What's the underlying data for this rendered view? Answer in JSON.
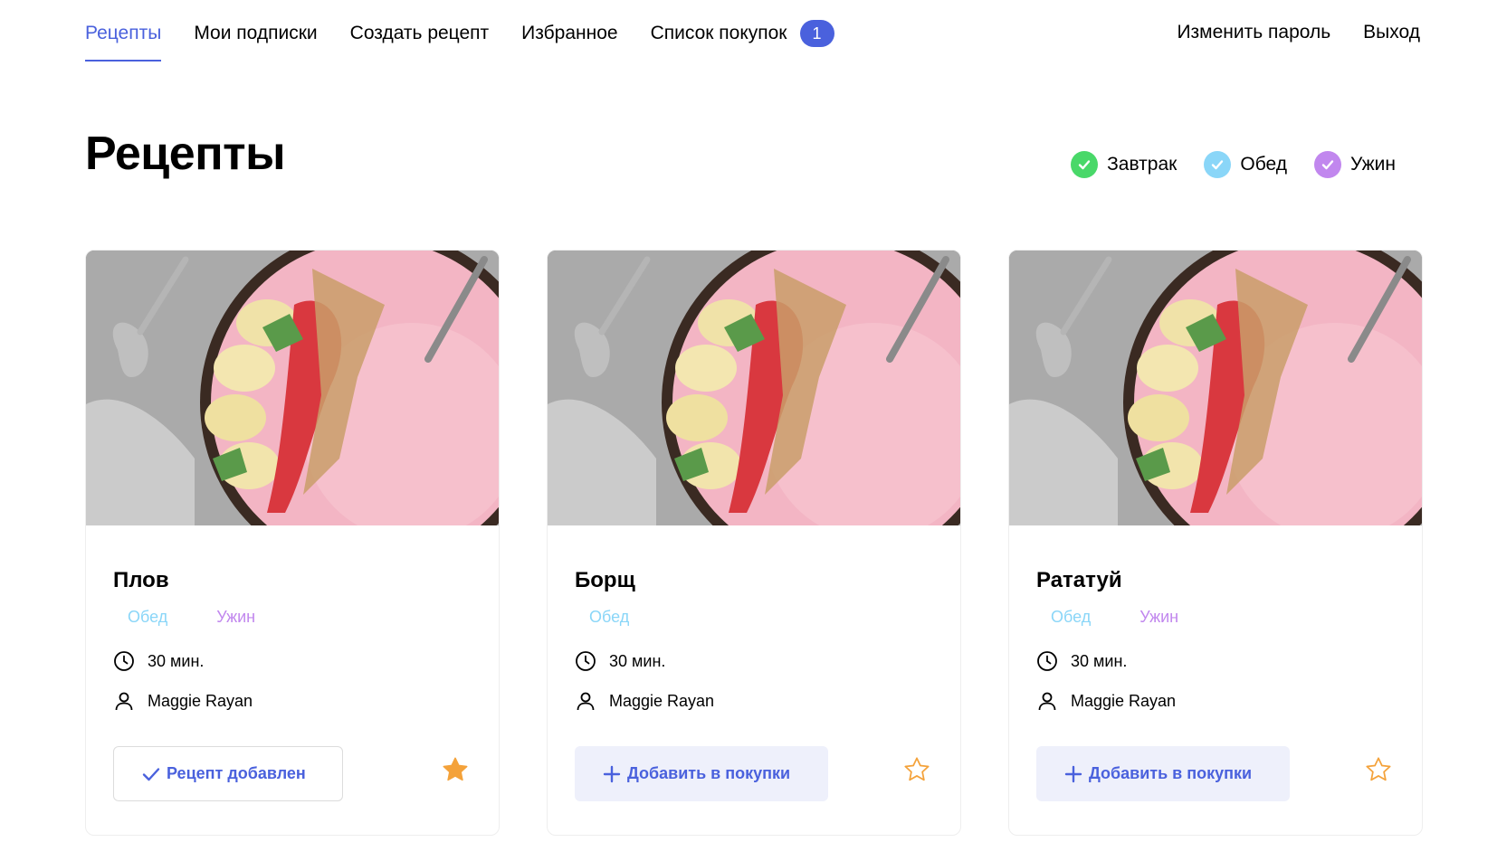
{
  "nav": {
    "items": [
      {
        "label": "Рецепты",
        "active": true
      },
      {
        "label": "Мои подписки",
        "active": false
      },
      {
        "label": "Создать рецепт",
        "active": false
      },
      {
        "label": "Избранное",
        "active": false
      },
      {
        "label": "Список покупок",
        "active": false,
        "badge": "1"
      }
    ],
    "right": [
      {
        "label": "Изменить пароль"
      },
      {
        "label": "Выход"
      }
    ]
  },
  "page": {
    "title": "Рецепты"
  },
  "filters": [
    {
      "label": "Завтрак",
      "color": "#49d869",
      "checked": true
    },
    {
      "label": "Обед",
      "color": "#8ad6f8",
      "checked": true
    },
    {
      "label": "Ужин",
      "color": "#c187ee",
      "checked": true
    }
  ],
  "colors": {
    "accent": "#4a61dd",
    "favorite": "#f4a23a",
    "tag_lunch": "#8ad6f8",
    "tag_dinner": "#c187ee"
  },
  "cards": [
    {
      "title": "Плов",
      "tags": [
        "Обед",
        "Ужин"
      ],
      "time": "30 мин.",
      "author": "Maggie Rayan",
      "action_label": "Рецепт добавлен",
      "action_state": "added",
      "favorite": true
    },
    {
      "title": "Борщ",
      "tags": [
        "Обед"
      ],
      "time": "30 мин.",
      "author": "Maggie Rayan",
      "action_label": "Добавить в покупки",
      "action_state": "add",
      "favorite": false
    },
    {
      "title": "Рататуй",
      "tags": [
        "Обед",
        "Ужин"
      ],
      "time": "30 мин.",
      "author": "Maggie Rayan",
      "action_label": "Добавить в покупки",
      "action_state": "add",
      "favorite": false
    }
  ],
  "icons": {
    "time": "clock-icon",
    "author": "user-icon",
    "added": "check-icon",
    "add": "plus-icon",
    "favorite": "star-icon",
    "filter": "check-circle-icon"
  }
}
